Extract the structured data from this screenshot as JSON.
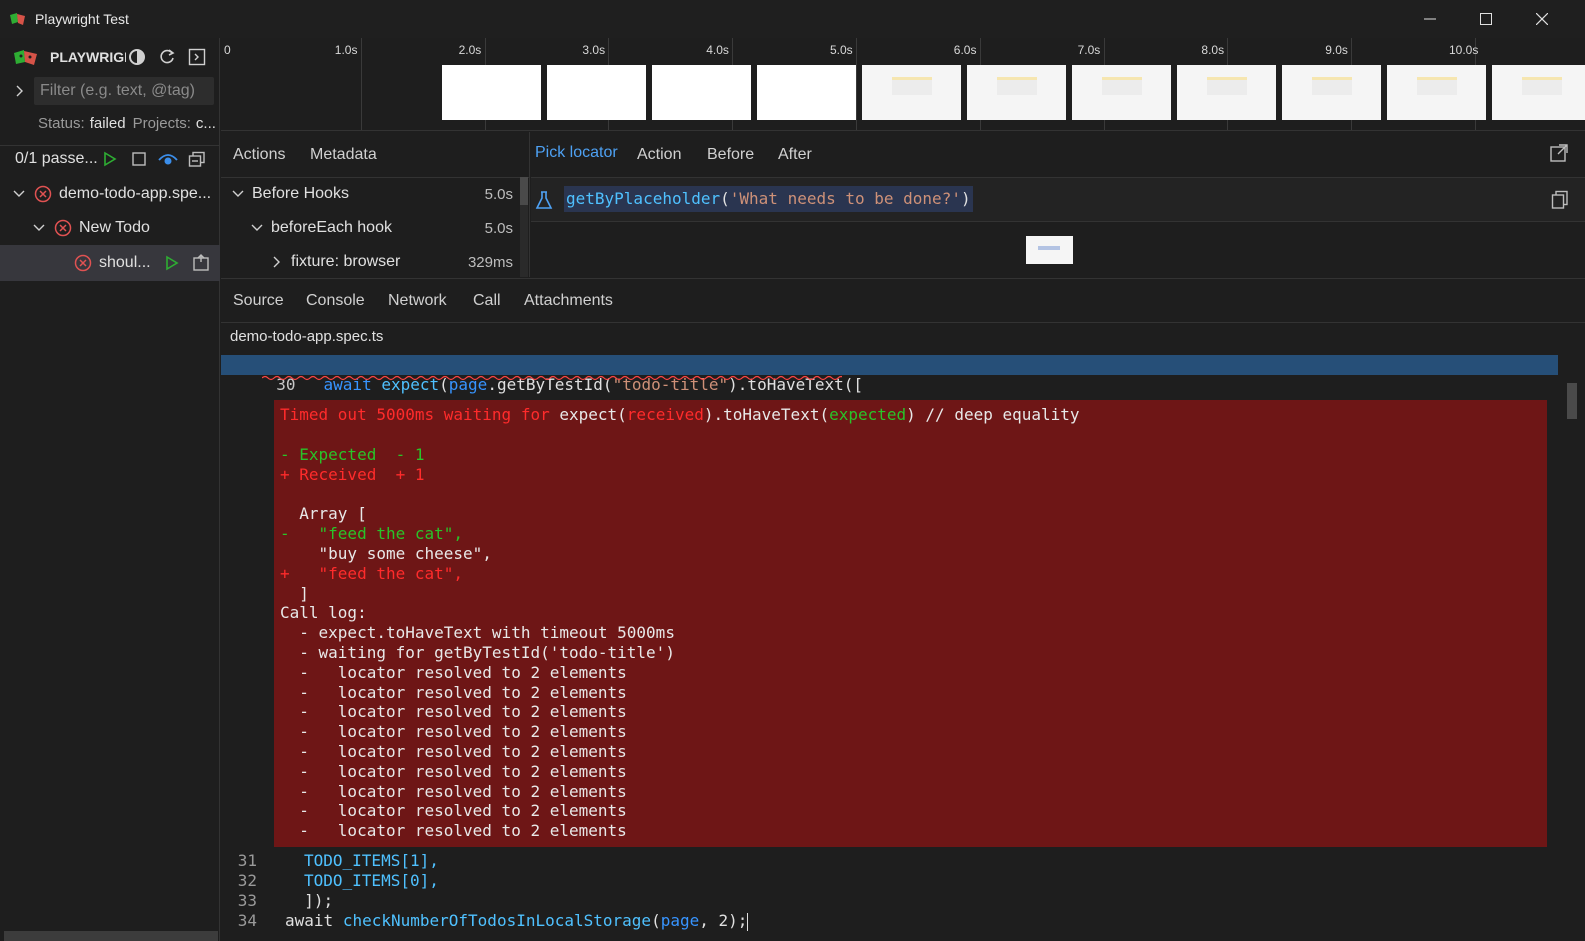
{
  "window": {
    "title": "Playwright Test"
  },
  "sidebar": {
    "brand": "PLAYWRIGHT",
    "filter_placeholder": "Filter (e.g. text, @tag)",
    "status_label": "Status:",
    "status_value": "failed",
    "projects_label": "Projects:",
    "projects_value": "c...",
    "pass_count": "0/1 passe...",
    "tree": [
      {
        "label": "demo-todo-app.spe...",
        "status": "failed"
      },
      {
        "label": "New Todo",
        "status": "failed"
      },
      {
        "label": "shoul...",
        "status": "failed"
      }
    ]
  },
  "timeline": {
    "ticks": [
      "0",
      "1.0s",
      "2.0s",
      "3.0s",
      "4.0s",
      "5.0s",
      "6.0s",
      "7.0s",
      "8.0s",
      "9.0s",
      "10.0s"
    ]
  },
  "actions_panel": {
    "tabs": [
      "Actions",
      "Metadata"
    ],
    "rows": [
      {
        "label": "Before Hooks",
        "duration": "5.0s",
        "expander": "open"
      },
      {
        "label": "beforeEach hook",
        "duration": "5.0s",
        "expander": "open"
      },
      {
        "label": "fixture: browser",
        "duration": "329ms",
        "expander": "closed"
      }
    ]
  },
  "locator_panel": {
    "tabs": [
      "Pick locator",
      "Action",
      "Before",
      "After"
    ],
    "active_tab": "Pick locator",
    "locator_fn": "getByPlaceholder",
    "locator_arg": "'What needs to be done?'"
  },
  "bottom_tabs": [
    "Source",
    "Console",
    "Network",
    "Call",
    "Attachments"
  ],
  "source": {
    "filename": "demo-todo-app.spec.ts",
    "line30_num": "30",
    "line30": {
      "kw": "await",
      "fn": "expect",
      "obj": "page",
      "method": "getByTestId",
      "arg": "\"todo-title\"",
      "tail": ".toHaveText(["
    },
    "error": {
      "timed_out": "Timed out 5000ms waiting for ",
      "expect_head": "expect(",
      "received": "received",
      "expect_mid": ").toHaveText(",
      "expected": "expected",
      "expect_tail": ") // deep equality",
      "exp_line": "- Expected  - 1",
      "rec_line": "+ Received  + 1",
      "array_open": "  Array [",
      "minus_item": "-   \"feed the cat\",",
      "same_item": "    \"buy some cheese\",",
      "plus_item": "+   \"feed the cat\",",
      "array_close": "  ]",
      "call_log": "Call log:",
      "log1": "  - expect.toHaveText with timeout 5000ms",
      "log2": "  - waiting for getByTestId('todo-title')",
      "resolved": "  -   locator resolved to 2 elements"
    },
    "line31_num": "31",
    "line31": "TODO_ITEMS[1],",
    "line32_num": "32",
    "line32": "TODO_ITEMS[0],",
    "line33_num": "33",
    "line33": "  ]);",
    "line34_num": "34",
    "line34_kw": "await",
    "line34_fn": "checkNumberOfTodosInLocalStorage",
    "line34_arg": "page",
    "line34_tail": ", 2);"
  }
}
